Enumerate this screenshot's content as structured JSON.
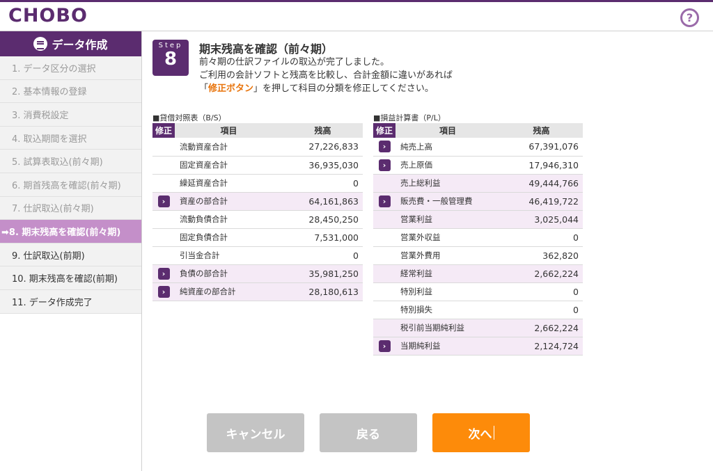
{
  "app": {
    "logo": "CHOBO",
    "help_icon": "?"
  },
  "sidebar": {
    "title": "データ作成",
    "items": [
      {
        "label": "1. データ区分の選択",
        "state": "done"
      },
      {
        "label": "2. 基本情報の登録",
        "state": "done"
      },
      {
        "label": "3. 消費税設定",
        "state": "done"
      },
      {
        "label": "4. 取込期間を選択",
        "state": "done"
      },
      {
        "label": "5. 試算表取込(前々期)",
        "state": "done"
      },
      {
        "label": "6. 期首残高を確認(前々期)",
        "state": "done"
      },
      {
        "label": "7. 仕訳取込(前々期)",
        "state": "done"
      },
      {
        "label": "➡8. 期末残高を確認(前々期)",
        "state": "active"
      },
      {
        "label": "9. 仕訳取込(前期)",
        "state": "todo"
      },
      {
        "label": "10. 期末残高を確認(前期)",
        "state": "todo"
      },
      {
        "label": "11. データ作成完了",
        "state": "todo"
      }
    ]
  },
  "step": {
    "label": "Step",
    "number": "8"
  },
  "main": {
    "title": "期末残高を確認（前々期）",
    "line1": "前々期の仕訳ファイルの取込が完了しました。",
    "line2": "ご利用の会計ソフトと残高を比較し、合計金額に違いがあれば",
    "line3_open": "「",
    "line3_accent": "修正ボタン",
    "line3_rest": "」を押して科目の分類を修正してください。"
  },
  "bs": {
    "caption": "■貸借対照表（B/S）",
    "headers": {
      "fix": "修正",
      "item": "項目",
      "balance": "残高"
    },
    "rows": [
      {
        "item": "流動資産合計",
        "balance": "27,226,833"
      },
      {
        "item": "固定資産合計",
        "balance": "36,935,030"
      },
      {
        "item": "繰延資産合計",
        "balance": "0"
      },
      {
        "item": "資産の部合計",
        "balance": "64,161,863"
      },
      {
        "item": "流動負債合計",
        "balance": "28,450,250"
      },
      {
        "item": "固定負債合計",
        "balance": "7,531,000"
      },
      {
        "item": "引当金合計",
        "balance": "0"
      },
      {
        "item": "負債の部合計",
        "balance": "35,981,250"
      },
      {
        "item": "純資産の部合計",
        "balance": "28,180,613"
      }
    ]
  },
  "pl": {
    "caption": "■損益計算書（P/L）",
    "headers": {
      "fix": "修正",
      "item": "項目",
      "balance": "残高"
    },
    "rows": [
      {
        "item": "純売上高",
        "balance": "67,391,076"
      },
      {
        "item": "売上原価",
        "balance": "17,946,310"
      },
      {
        "item": "売上総利益",
        "balance": "49,444,766"
      },
      {
        "item": "販売費・一般管理費",
        "balance": "46,419,722"
      },
      {
        "item": "営業利益",
        "balance": "3,025,044"
      },
      {
        "item": "営業外収益",
        "balance": "0"
      },
      {
        "item": "営業外費用",
        "balance": "362,820"
      },
      {
        "item": "経常利益",
        "balance": "2,662,224"
      },
      {
        "item": "特別利益",
        "balance": "0"
      },
      {
        "item": "特別損失",
        "balance": "0"
      },
      {
        "item": "税引前当期純利益",
        "balance": "2,662,224"
      },
      {
        "item": "当期純利益",
        "balance": "2,124,724"
      }
    ]
  },
  "buttons": {
    "cancel": "キャンセル",
    "back": "戻る",
    "next": "次へ"
  },
  "colors": {
    "brand": "#5b2c6f",
    "active": "#c48fc9",
    "highlight_row": "#f5eaf6",
    "accent": "#fd8b0a"
  }
}
